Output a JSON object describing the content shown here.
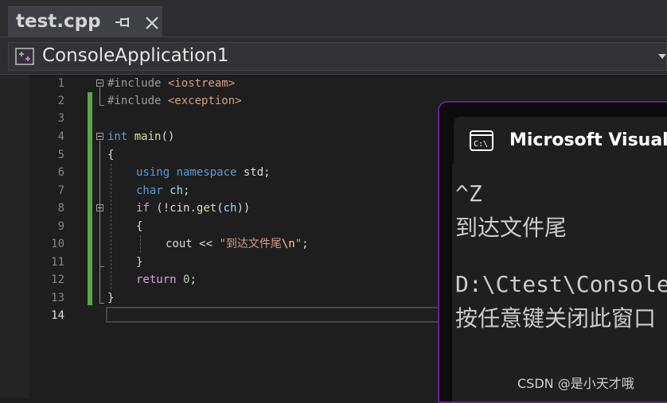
{
  "tab": {
    "title": "test.cpp"
  },
  "nav": {
    "project": "ConsoleApplication1"
  },
  "editor": {
    "lines": [
      "1",
      "2",
      "3",
      "4",
      "5",
      "6",
      "7",
      "8",
      "9",
      "10",
      "11",
      "12",
      "13",
      "14"
    ],
    "active_line": "14",
    "code": {
      "l1_pp": "#include ",
      "l1_hdr": "<iostream>",
      "l2_pp": "#include ",
      "l2_hdr": "<exception>",
      "l4_type": "int",
      "l4_fn": " main",
      "l4_rest": "()",
      "l5": "{",
      "l6_kw": "using namespace",
      "l6_ns": " std",
      "l6_rest": ";",
      "l7_kw": "char",
      "l7_var": " ch",
      "l7_rest": ";",
      "l8_kw": "if",
      "l8_a": " (!",
      "l8_obj": "cin",
      "l8_dot": ".",
      "l8_fn": "get",
      "l8_b": "(",
      "l8_var": "ch",
      "l8_c": "))",
      "l9": "{",
      "l10_a": "cout << ",
      "l10_str": "\"到达文件尾",
      "l10_esc": "\\n",
      "l10_q": "\"",
      "l10_end": ";",
      "l11": "}",
      "l12_kw": "return",
      "l12_num": " 0",
      "l12_end": ";",
      "l13": "}"
    }
  },
  "console": {
    "title": "Microsoft Visual Studio",
    "lines": [
      "^Z",
      "到达文件尾",
      "",
      "D:\\Ctest\\Console",
      "按任意键关闭此窗口"
    ]
  },
  "watermark": "CSDN @是小天才哦"
}
